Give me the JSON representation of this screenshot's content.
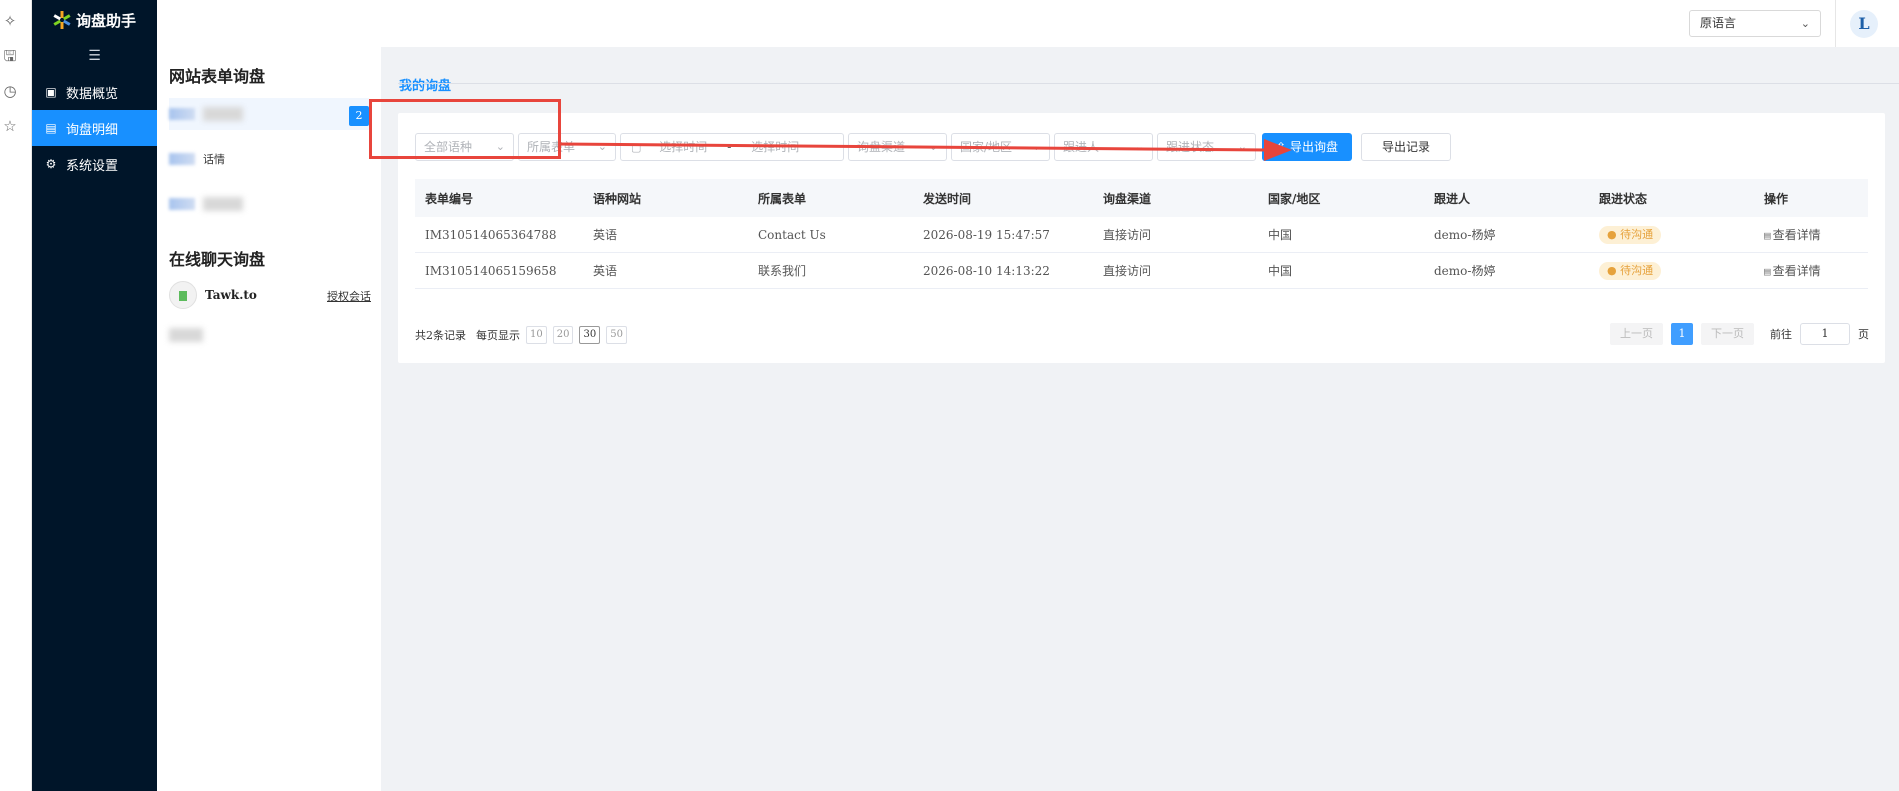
{
  "app": {
    "name": "询盘助手",
    "brand_color": "#1890ff",
    "sidebar_bg": "#001529"
  },
  "strip_icons": [
    "sparkle-icon",
    "save-icon",
    "clock-icon",
    "star-icon"
  ],
  "sidebar": {
    "collapse_icon": "indent-icon",
    "items": [
      {
        "label": "数据概览",
        "icon": "chart-icon",
        "active": false
      },
      {
        "label": "询盘明细",
        "icon": "message-icon",
        "active": true
      },
      {
        "label": "系统设置",
        "icon": "gear-icon",
        "active": false
      }
    ]
  },
  "header": {
    "language_select": "原语言",
    "avatar_letter": "L"
  },
  "panel2": {
    "form_section_title": "网站表单询盘",
    "form_items": [
      {
        "label": "",
        "badge": "2"
      },
      {
        "label": "话情"
      },
      {
        "label": ""
      }
    ],
    "chat_section_title": "在线聊天询盘",
    "chat_items": [
      {
        "name": "Tawk.to",
        "action": "授权会话"
      }
    ]
  },
  "main": {
    "tab_title": "我的询盘",
    "filters": {
      "language": "全部语种",
      "form": "所属表单",
      "start_time": "选择时间",
      "time_separator": "-",
      "end_time": "选择时间",
      "channel": "询盘渠道",
      "country": "国家/地区",
      "follower": "跟进人",
      "status": "跟进状态"
    },
    "export_button": "导出询盘",
    "export_records_button": "导出记录",
    "table": {
      "columns": [
        "表单编号",
        "语种网站",
        "所属表单",
        "发送时间",
        "询盘渠道",
        "国家/地区",
        "跟进人",
        "跟进状态",
        "操作"
      ],
      "rows": [
        {
          "id": "IM310514065364788",
          "language": "英语",
          "form": "Contact Us",
          "time": "2026-08-19 15:47:57",
          "channel": "直接访问",
          "country": "中国",
          "follower": "demo-杨婷",
          "status": "● 待沟通",
          "action": "查看详情"
        },
        {
          "id": "IM310514065159658",
          "language": "英语",
          "form": "联系我们",
          "time": "2026-08-10 14:13:22",
          "channel": "直接访问",
          "country": "中国",
          "follower": "demo-杨婷",
          "status": "● 待沟通",
          "action": "查看详情"
        }
      ]
    },
    "pagination": {
      "total": "共2条记录",
      "per_page_label": "每页显示",
      "size_options": [
        "10",
        "20",
        "30",
        "50"
      ],
      "current_size": "30",
      "prev": "上一页",
      "current_page": "1",
      "next": "下一页",
      "goto_label": "前往",
      "goto_value": "1",
      "page_suffix": "页"
    }
  },
  "annotation_color": "#e8453c"
}
